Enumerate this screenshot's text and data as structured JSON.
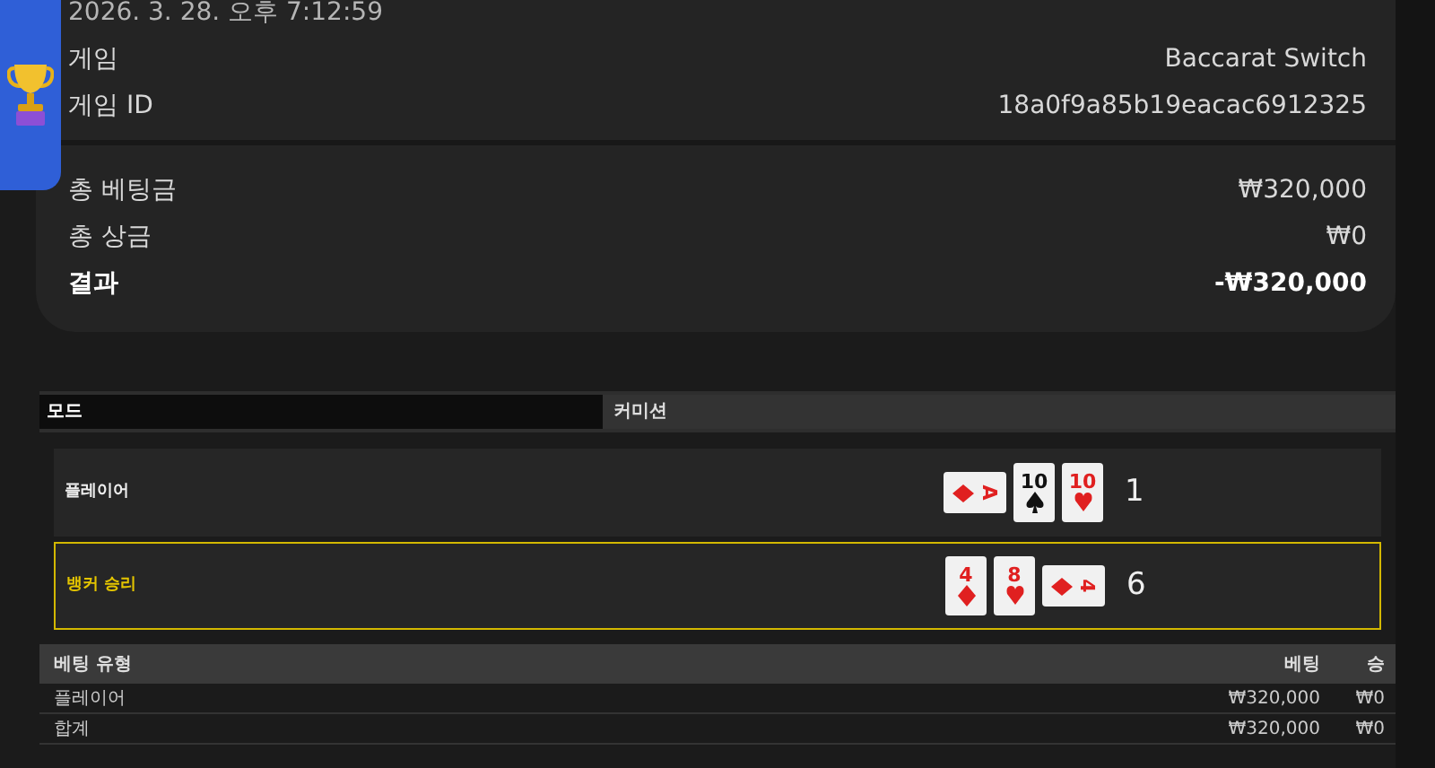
{
  "summary": {
    "datetime": "2026. 3. 28. 오후 7:12:59",
    "details": [
      {
        "label": "게임",
        "value": "Baccarat Switch"
      },
      {
        "label": "게임 ID",
        "value": "18a0f9a85b19eacac6912325"
      }
    ],
    "totals": [
      {
        "label": "총 베팅금",
        "value": "₩320,000",
        "bold": false
      },
      {
        "label": "총 상금",
        "value": "₩0",
        "bold": false
      },
      {
        "label": "결과",
        "value": "-₩320,000",
        "bold": true
      }
    ]
  },
  "mode_header": {
    "column_1": "모드",
    "column_2": "커미션"
  },
  "hands": [
    {
      "label": "플레이어",
      "winner": false,
      "score": "1",
      "cards": [
        {
          "rank": "A",
          "kind": "diamond",
          "sideways": true
        },
        {
          "rank": "10",
          "kind": "spade",
          "sideways": false
        },
        {
          "rank": "10",
          "kind": "heart",
          "sideways": false
        }
      ]
    },
    {
      "label": "뱅커 승리",
      "winner": true,
      "score": "6",
      "cards": [
        {
          "rank": "4",
          "kind": "diamond",
          "sideways": false
        },
        {
          "rank": "8",
          "kind": "heart",
          "sideways": false
        },
        {
          "rank": "4",
          "kind": "diamond",
          "sideways": true
        }
      ]
    }
  ],
  "bets": {
    "columns": [
      "베팅 유형",
      "베팅",
      "승"
    ],
    "rows": [
      [
        "플레이어",
        "₩320,000",
        "₩0"
      ],
      [
        "합계",
        "₩320,000",
        "₩0"
      ]
    ]
  }
}
